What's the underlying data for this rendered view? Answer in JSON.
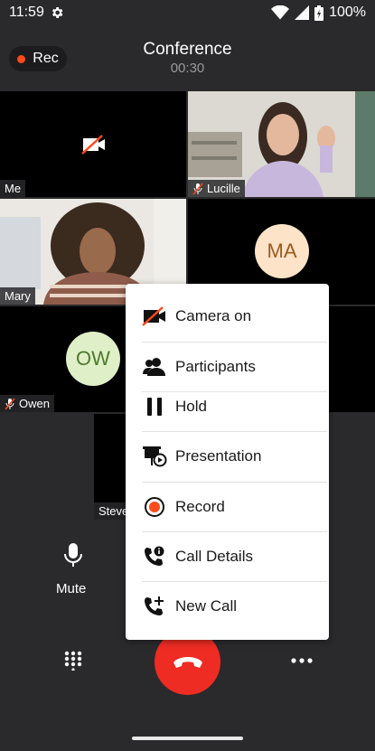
{
  "status": {
    "time": "11:59",
    "battery": "100%"
  },
  "header": {
    "rec_label": "Rec",
    "title": "Conference",
    "timer": "00:30"
  },
  "tiles": {
    "me": "Me",
    "lucille": "Lucille",
    "mary": "Mary",
    "ma_initials": "MA",
    "ow_initials": "OW",
    "owen": "Owen",
    "steve": "Steve"
  },
  "menu": {
    "items": [
      {
        "label": "Camera on",
        "icon": "camera-off-icon"
      },
      {
        "label": "Participants",
        "icon": "participants-icon"
      },
      {
        "label": "Hold",
        "icon": "pause-icon"
      },
      {
        "label": "Presentation",
        "icon": "presentation-icon"
      },
      {
        "label": "Record",
        "icon": "record-icon"
      },
      {
        "label": "Call Details",
        "icon": "call-details-icon"
      },
      {
        "label": "New Call",
        "icon": "add-call-icon"
      }
    ]
  },
  "controls": {
    "mute_label": "Mute"
  },
  "colors": {
    "rec": "#ff4a1a",
    "end_call": "#ee2c23",
    "avatar_ma": "#fde3c8",
    "avatar_ow": "#dff0c9"
  }
}
